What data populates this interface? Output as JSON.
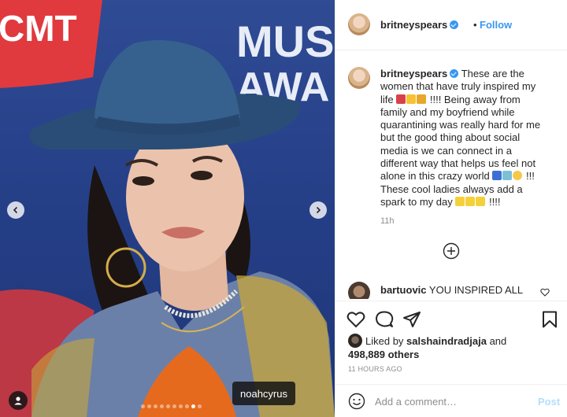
{
  "post": {
    "username": "britneyspears",
    "follow_label": "Follow",
    "dot_separator": "•",
    "photo_tag": "noahcyrus",
    "backdrop_left_text": "CMT",
    "backdrop_right_lines": [
      "MUS",
      "AWA"
    ],
    "carousel": {
      "slides": 10,
      "active_index": 8
    }
  },
  "caption": {
    "username": "britneyspears",
    "parts": [
      "These are the women that have truly inspired my life",
      "!!!! Being away from family and my boyfriend while quarantining was really hard for me but the good thing about social media is we can connect in a different way that helps us feel not alone in this crazy world",
      "!!!  These cool ladies always add a spark to my day",
      "!!!!"
    ],
    "time": "11h"
  },
  "comment": {
    "username": "bartuovic",
    "text": "YOU INSPIRED ALL"
  },
  "likes": {
    "prefix": "Liked by",
    "liker": "salshaindradjaja",
    "connector": "and",
    "count": "498,889 others"
  },
  "timestamp": "11 HOURS AGO",
  "comment_box": {
    "placeholder": "Add a comment…",
    "post_label": "Post"
  },
  "colors": {
    "accent": "#3897f0",
    "post_disabled": "#b2dffc",
    "backdrop_blue": "#2f4b93",
    "cmt_red": "#e03a3e"
  },
  "icons": [
    "chevron-left-icon",
    "chevron-right-icon",
    "user-tag-icon",
    "verified-icon",
    "add-circle-icon",
    "heart-icon",
    "comment-icon",
    "share-icon",
    "bookmark-icon",
    "emoji-icon"
  ]
}
